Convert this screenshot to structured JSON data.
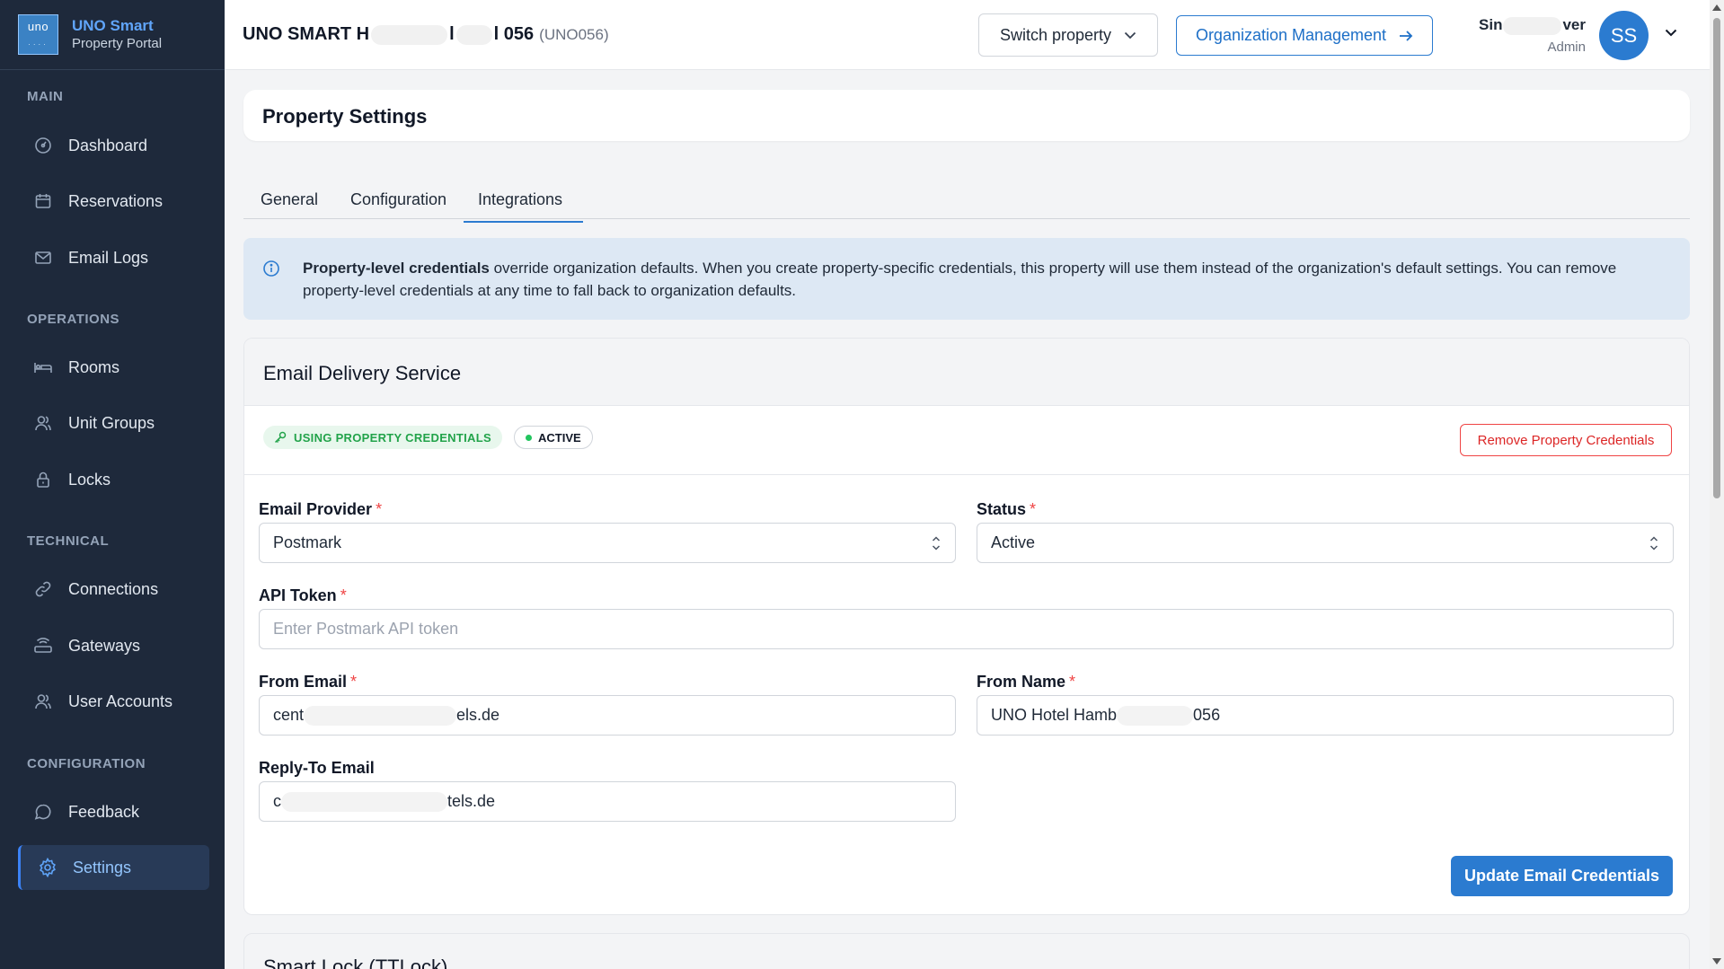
{
  "brand": {
    "logo_text": "uno",
    "title": "UNO Smart",
    "subtitle": "Property Portal"
  },
  "sidebar": {
    "sections": [
      {
        "label": "MAIN",
        "items": [
          {
            "label": "Dashboard",
            "icon": "dashboard-icon"
          },
          {
            "label": "Reservations",
            "icon": "calendar-icon"
          },
          {
            "label": "Email Logs",
            "icon": "mail-icon"
          }
        ]
      },
      {
        "label": "OPERATIONS",
        "items": [
          {
            "label": "Rooms",
            "icon": "bed-icon"
          },
          {
            "label": "Unit Groups",
            "icon": "users-icon"
          },
          {
            "label": "Locks",
            "icon": "lock-icon"
          }
        ]
      },
      {
        "label": "TECHNICAL",
        "items": [
          {
            "label": "Connections",
            "icon": "link-icon"
          },
          {
            "label": "Gateways",
            "icon": "router-icon"
          },
          {
            "label": "User Accounts",
            "icon": "users-icon"
          }
        ]
      },
      {
        "label": "CONFIGURATION",
        "items": [
          {
            "label": "Feedback",
            "icon": "chat-icon"
          },
          {
            "label": "Settings",
            "icon": "gear-icon",
            "active": true
          }
        ]
      }
    ]
  },
  "header": {
    "property_title_start": "UNO SMART H",
    "property_title_mid": "l",
    "property_title_end": "l 056",
    "property_code": "(UNO056)",
    "switch_label": "Switch property",
    "org_label": "Organization Management",
    "user_name_start": "Sin",
    "user_name_end": "ver",
    "user_role": "Admin",
    "avatar_initials": "SS"
  },
  "page": {
    "title": "Property Settings",
    "tabs": [
      "General",
      "Configuration",
      "Integrations"
    ],
    "active_tab": "Integrations"
  },
  "info": {
    "bold": "Property-level credentials",
    "text": " override organization defaults. When you create property-specific credentials, this property will use them instead of the organization's default settings. You can remove property-level credentials at any time to fall back to organization defaults."
  },
  "email_service": {
    "title": "Email Delivery Service",
    "badge_credentials": "USING PROPERTY CREDENTIALS",
    "badge_status": "ACTIVE",
    "remove_label": "Remove Property Credentials",
    "provider_label": "Email Provider",
    "provider_value": "Postmark",
    "status_label": "Status",
    "status_value": "Active",
    "token_label": "API Token",
    "token_placeholder": "Enter Postmark API token",
    "from_email_label": "From Email",
    "from_email_start": "cent",
    "from_email_end": "els.de",
    "from_name_label": "From Name",
    "from_name_start": "UNO Hotel Hamb",
    "from_name_end": "056",
    "reply_to_label": "Reply-To Email",
    "reply_to_start": "c",
    "reply_to_end": "tels.de",
    "update_label": "Update Email Credentials",
    "required_mark": "*"
  },
  "smart_lock": {
    "title": "Smart Lock (TTLock)"
  },
  "colors": {
    "accent": "#2b7bd0",
    "sidebar_bg": "#1e293b",
    "success": "#22a34a",
    "danger": "#dc2626"
  }
}
